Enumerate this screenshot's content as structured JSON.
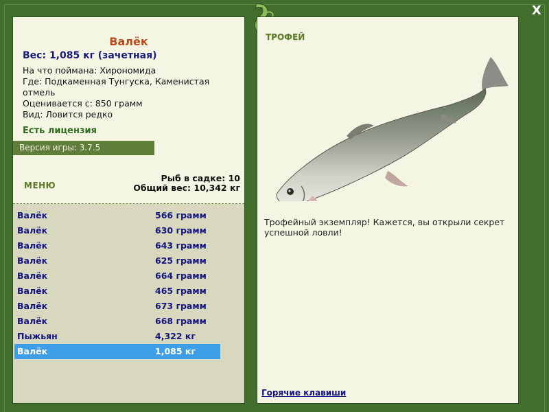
{
  "close_label": "X",
  "fish": {
    "title": "Валёк",
    "weight": "Вес: 1,085 кг (зачетная)",
    "bait": "На что поймана: Хирономида",
    "place": "Где: Подкаменная Тунгуска, Каменистая отмель",
    "value": "Оценивается с: 850 грамм",
    "kind": "Вид: Ловится редко",
    "license": "Есть лицензия"
  },
  "version": "Версия игры: 3.7.5",
  "menu_label": "МЕНЮ",
  "stats": {
    "keep_net": "Рыб в садке: 10",
    "total_weight": "Общий вес: 10,342 кг"
  },
  "catches": [
    {
      "name": "Валёк",
      "weight": "566 грамм"
    },
    {
      "name": "Валёк",
      "weight": "630 грамм"
    },
    {
      "name": "Валёк",
      "weight": "643 грамм"
    },
    {
      "name": "Валёк",
      "weight": "625 грамм"
    },
    {
      "name": "Валёк",
      "weight": "664 грамм"
    },
    {
      "name": "Валёк",
      "weight": "465 грамм"
    },
    {
      "name": "Валёк",
      "weight": "673 грамм"
    },
    {
      "name": "Валёк",
      "weight": "668 грамм"
    },
    {
      "name": "Пыжьян",
      "weight": "4,322 кг"
    },
    {
      "name": "Валёк",
      "weight": "1,085 кг",
      "selected": true
    }
  ],
  "trophy": {
    "title": "ТРОФЕЙ",
    "text": "Трофейный экземпляр! Кажется, вы открыли секрет успешной ловли!"
  },
  "hotkeys_label": "Горячие клавиши",
  "colors": {
    "frame": "#426e2d",
    "panel": "#f5f5e3",
    "selected_row": "#3f9ee8",
    "fish_title": "#b84c1a"
  }
}
